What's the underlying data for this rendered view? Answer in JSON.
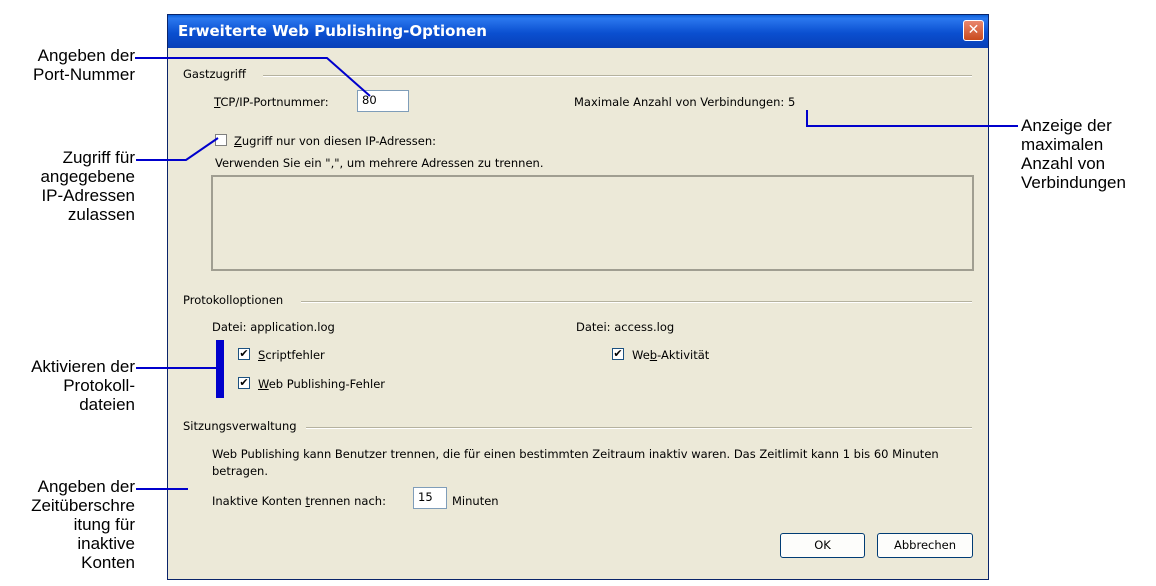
{
  "window": {
    "title": "Erweiterte Web Publishing-Optionen",
    "close_glyph": "✕"
  },
  "gast": {
    "section_label": "Gastzugriff",
    "port_label_prefix": "T",
    "port_label_rest": "CP/IP-Portnummer:",
    "port_value": "80",
    "max_connections": "Maximale Anzahl von Verbindungen: 5",
    "restrict_checked": false,
    "restrict_label_prefix": "Z",
    "restrict_label_rest": "ugriff nur von diesen IP-Adressen:",
    "separator_hint": "Verwenden Sie ein \",\", um mehrere Adressen zu trennen.",
    "ip_addresses_value": ""
  },
  "protokoll": {
    "section_label": "Protokolloptionen",
    "file1_label": "Datei: application.log",
    "file2_label": "Datei: access.log",
    "script_errors": {
      "checked": true,
      "prefix": "S",
      "rest": "criptfehler"
    },
    "wp_errors": {
      "checked": true,
      "prefix": "W",
      "rest": "eb Publishing-Fehler"
    },
    "web_activity": {
      "checked": true,
      "before": "We",
      "key": "b",
      "after": "-Aktivität"
    }
  },
  "sitzung": {
    "section_label": "Sitzungsverwaltung",
    "description_line1": "Web Publishing kann Benutzer trennen, die für einen bestimmten Zeitraum inaktiv waren. Das Zeitlimit kann 1 bis 60 Minuten",
    "description_line2": "betragen.",
    "timeout_label_before": "Inaktive Konten ",
    "timeout_label_key": "t",
    "timeout_label_after": "rennen nach:",
    "timeout_value": "15",
    "timeout_unit": "Minuten"
  },
  "buttons": {
    "ok": "OK",
    "cancel": "Abbrechen"
  },
  "callouts": {
    "port": [
      "Angeben der",
      "Port-Nummer"
    ],
    "ip_access": [
      "Zugriff für",
      "angegebene",
      "IP-Adressen",
      "zulassen"
    ],
    "logs": [
      "Aktivieren der",
      "Protokoll-",
      "dateien"
    ],
    "timeout": [
      "Angeben der",
      "Zeitüberschre",
      "itung für",
      "inaktive",
      "Konten"
    ],
    "max_conn": [
      "Anzeige der",
      "maximalen",
      "Anzahl von",
      "Verbindungen"
    ]
  },
  "colors": {
    "titlebar": "#0a4fd0",
    "dialog_bg": "#ece9d8",
    "callout_line": "#0000cc",
    "close": "#c94a1e"
  }
}
